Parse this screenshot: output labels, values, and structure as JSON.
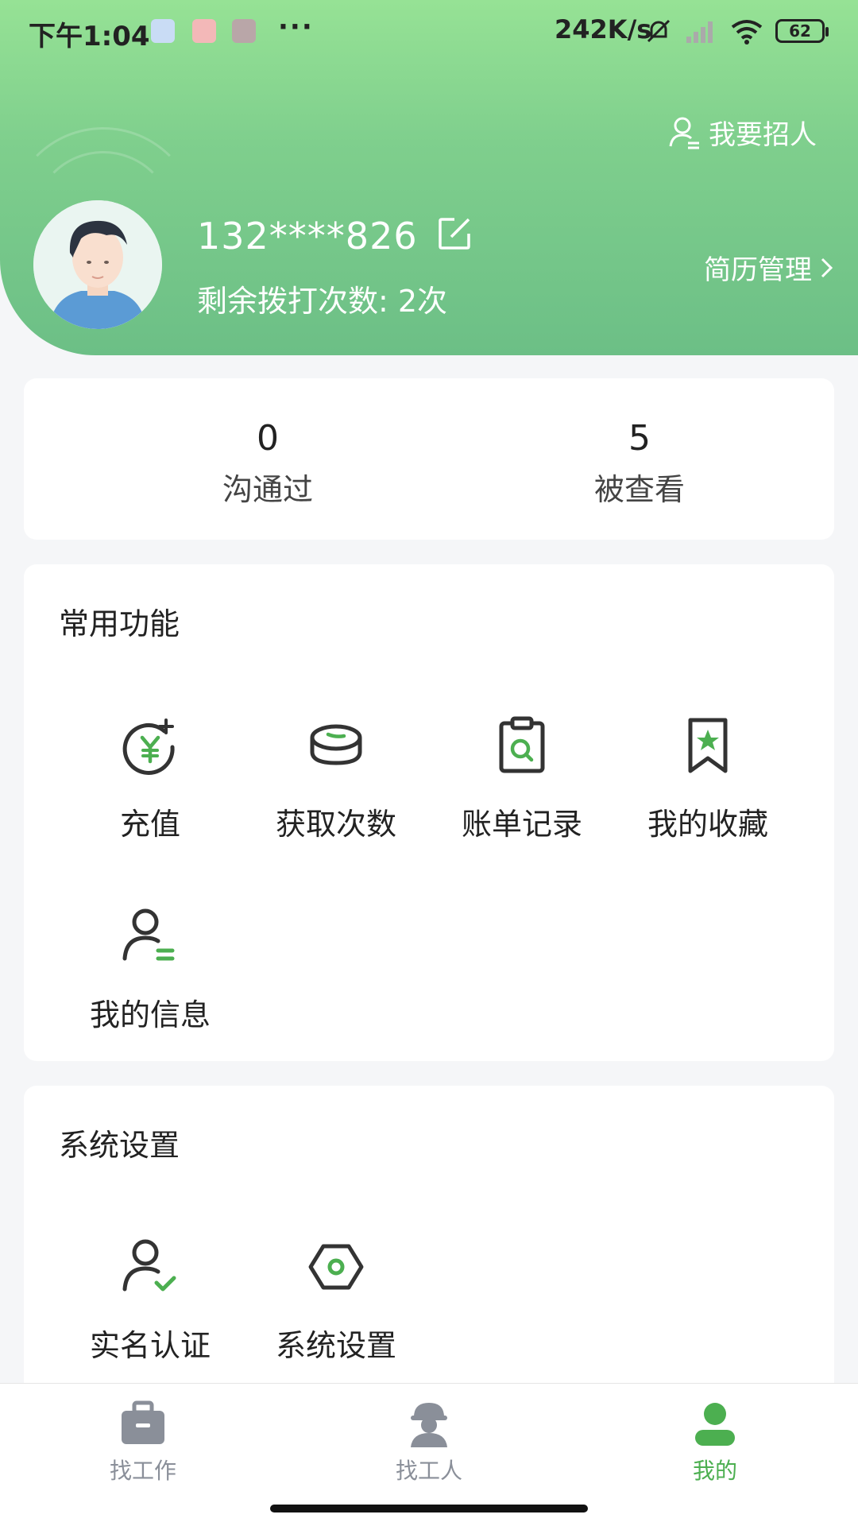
{
  "status_bar": {
    "time": "下午1:04",
    "dots": "···",
    "speed": "242K/s",
    "battery": "62"
  },
  "header": {
    "recruit_label": "我要招人",
    "phone": "132****826",
    "remaining_calls": "剩余拨打次数: 2次",
    "resume_label": "简历管理"
  },
  "stats": [
    {
      "value": "0",
      "label": "沟通过"
    },
    {
      "value": "5",
      "label": "被查看"
    }
  ],
  "common_functions": {
    "title": "常用功能",
    "items": [
      {
        "label": "充值",
        "icon": "yen-plus-icon"
      },
      {
        "label": "获取次数",
        "icon": "coins-icon"
      },
      {
        "label": "账单记录",
        "icon": "clipboard-search-icon"
      },
      {
        "label": "我的收藏",
        "icon": "bookmark-star-icon"
      },
      {
        "label": "我的信息",
        "icon": "user-info-icon"
      }
    ]
  },
  "system_settings": {
    "title": "系统设置",
    "items": [
      {
        "label": "实名认证",
        "icon": "user-check-icon"
      },
      {
        "label": "系统设置",
        "icon": "hexagon-settings-icon"
      }
    ]
  },
  "bottom_nav": [
    {
      "label": "找工作",
      "icon": "briefcase-icon",
      "active": false
    },
    {
      "label": "找工人",
      "icon": "worker-icon",
      "active": false
    },
    {
      "label": "我的",
      "icon": "person-icon",
      "active": true
    }
  ],
  "colors": {
    "accent": "#4caf50",
    "header_top": "#96e295",
    "header_bottom": "#6cbf86"
  }
}
